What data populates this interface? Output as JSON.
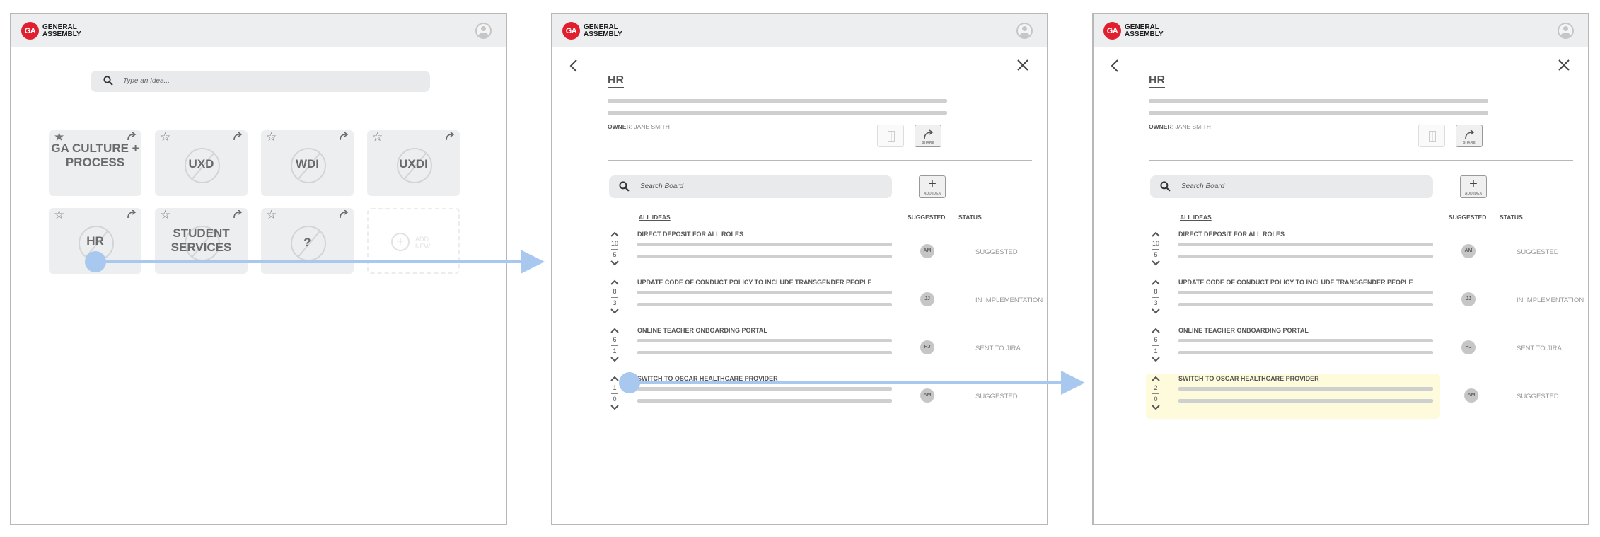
{
  "brand": {
    "badge": "GA",
    "line1": "GENERAL",
    "line2": "ASSEMBLY"
  },
  "home": {
    "search_placeholder": "Type an Idea...",
    "tiles": [
      {
        "label": "GA CULTURE + PROCESS",
        "starred": true
      },
      {
        "label": "UXD",
        "starred": false
      },
      {
        "label": "WDI",
        "starred": false
      },
      {
        "label": "UXDI",
        "starred": false
      },
      {
        "label": "HR",
        "starred": false
      },
      {
        "label": "STUDENT SERVICES",
        "starred": false
      },
      {
        "label": "?",
        "starred": false
      }
    ],
    "add_new_label": "ADD NEW"
  },
  "board": {
    "title": "HR",
    "owner_label": "OWNER",
    "owner_name": ": JANE SMITH",
    "share_label": "SHARE",
    "search_placeholder": "Search Board",
    "add_idea_label": "ADD IDEA",
    "columns": {
      "ideas": "ALL IDEAS",
      "suggested": "SUGGESTED",
      "status": "STATUS"
    },
    "ideas": [
      {
        "title": "DIRECT DEPOSIT FOR ALL ROLES",
        "up": "10",
        "down": "5",
        "initials": "AM",
        "status": "SUGGESTED"
      },
      {
        "title": "UPDATE CODE OF CONDUCT POLICY TO INCLUDE TRANSGENDER PEOPLE",
        "up": "8",
        "down": "3",
        "initials": "JJ",
        "status": "IN IMPLEMENTATION"
      },
      {
        "title": "ONLINE TEACHER ONBOARDING PORTAL",
        "up": "6",
        "down": "1",
        "initials": "RJ",
        "status": "SENT TO JIRA"
      },
      {
        "title": "SWITCH TO OSCAR HEALTHCARE PROVIDER",
        "up": "1",
        "down": "0",
        "initials": "AM",
        "status": "SUGGESTED"
      }
    ],
    "ideas_after_vote": [
      {
        "title": "DIRECT DEPOSIT FOR ALL ROLES",
        "up": "10",
        "down": "5",
        "initials": "AM",
        "status": "SUGGESTED"
      },
      {
        "title": "UPDATE CODE OF CONDUCT POLICY TO INCLUDE TRANSGENDER PEOPLE",
        "up": "8",
        "down": "3",
        "initials": "JJ",
        "status": "IN IMPLEMENTATION"
      },
      {
        "title": "ONLINE TEACHER ONBOARDING PORTAL",
        "up": "6",
        "down": "1",
        "initials": "RJ",
        "status": "SENT TO JIRA"
      },
      {
        "title": "SWITCH TO OSCAR HEALTHCARE PROVIDER",
        "up": "2",
        "down": "0",
        "initials": "AM",
        "status": "SUGGESTED"
      }
    ]
  },
  "colors": {
    "brand_red": "#e0202e",
    "flow_arrow": "#a8c8f0",
    "highlight": "#fefbdc"
  }
}
